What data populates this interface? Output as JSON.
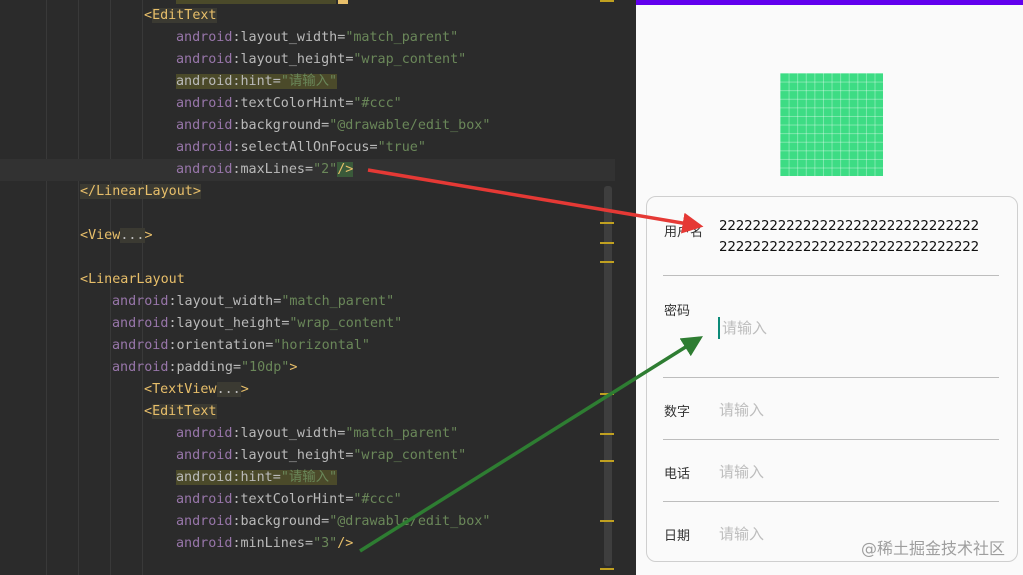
{
  "editor": {
    "lines": [
      {
        "tokens": [
          {
            "t": "<",
            "c": "tk-punc"
          },
          {
            "t": "EditText",
            "c": "tk-tag tk-tagbg"
          }
        ]
      },
      {
        "tokens": [
          {
            "t": "android",
            "c": "tk-ns"
          },
          {
            "t": ":",
            "c": "tk-attr"
          },
          {
            "t": "layout_width",
            "c": "tk-attr"
          },
          {
            "t": "=",
            "c": "tk-attr"
          },
          {
            "t": "\"match_parent\"",
            "c": "tk-val"
          }
        ]
      },
      {
        "tokens": [
          {
            "t": "android",
            "c": "tk-ns"
          },
          {
            "t": ":",
            "c": "tk-attr"
          },
          {
            "t": "layout_height",
            "c": "tk-attr"
          },
          {
            "t": "=",
            "c": "tk-attr"
          },
          {
            "t": "\"wrap_content\"",
            "c": "tk-val"
          }
        ]
      },
      {
        "tokens": [
          {
            "t": "android:hint",
            "c": "tk-attr tk-hlbg"
          },
          {
            "t": "=",
            "c": "tk-attr tk-hlbg"
          },
          {
            "t": "\"请输入\"",
            "c": "tk-val tk-hlbg"
          }
        ]
      },
      {
        "tokens": [
          {
            "t": "android",
            "c": "tk-ns"
          },
          {
            "t": ":",
            "c": "tk-attr"
          },
          {
            "t": "textColorHint",
            "c": "tk-attr"
          },
          {
            "t": "=",
            "c": "tk-attr"
          },
          {
            "t": "\"#ccc\"",
            "c": "tk-val"
          }
        ]
      },
      {
        "tokens": [
          {
            "t": "android",
            "c": "tk-ns"
          },
          {
            "t": ":",
            "c": "tk-attr"
          },
          {
            "t": "background",
            "c": "tk-attr"
          },
          {
            "t": "=",
            "c": "tk-attr"
          },
          {
            "t": "\"@drawable/edit_box\"",
            "c": "tk-val"
          }
        ]
      },
      {
        "tokens": [
          {
            "t": "android",
            "c": "tk-ns"
          },
          {
            "t": ":",
            "c": "tk-attr"
          },
          {
            "t": "selectAllOnFocus",
            "c": "tk-attr"
          },
          {
            "t": "=",
            "c": "tk-attr"
          },
          {
            "t": "\"true\"",
            "c": "tk-val"
          }
        ]
      },
      {
        "tokens": [
          {
            "t": "android",
            "c": "tk-ns"
          },
          {
            "t": ":",
            "c": "tk-attr"
          },
          {
            "t": "maxLines",
            "c": "tk-attr"
          },
          {
            "t": "=",
            "c": "tk-attr"
          },
          {
            "t": "\"2\"",
            "c": "tk-val"
          },
          {
            "t": "/>",
            "c": "tk-punc tk-caret"
          }
        ]
      },
      {
        "tokens": [
          {
            "t": "</LinearLayout>",
            "c": "tk-tag tk-tagbg"
          }
        ]
      },
      {
        "tokens": []
      },
      {
        "tokens": [
          {
            "t": "<",
            "c": "tk-punc"
          },
          {
            "t": "View",
            "c": "tk-tag"
          },
          {
            "t": "...",
            "c": "tk-attr tk-tagbg"
          },
          {
            "t": ">",
            "c": "tk-punc"
          }
        ]
      },
      {
        "tokens": []
      },
      {
        "tokens": [
          {
            "t": "<",
            "c": "tk-punc"
          },
          {
            "t": "LinearLayout",
            "c": "tk-tag"
          }
        ]
      },
      {
        "tokens": [
          {
            "t": "android",
            "c": "tk-ns"
          },
          {
            "t": ":",
            "c": "tk-attr"
          },
          {
            "t": "layout_width",
            "c": "tk-attr"
          },
          {
            "t": "=",
            "c": "tk-attr"
          },
          {
            "t": "\"match_parent\"",
            "c": "tk-val"
          }
        ]
      },
      {
        "tokens": [
          {
            "t": "android",
            "c": "tk-ns"
          },
          {
            "t": ":",
            "c": "tk-attr"
          },
          {
            "t": "layout_height",
            "c": "tk-attr"
          },
          {
            "t": "=",
            "c": "tk-attr"
          },
          {
            "t": "\"wrap_content\"",
            "c": "tk-val"
          }
        ]
      },
      {
        "tokens": [
          {
            "t": "android",
            "c": "tk-ns"
          },
          {
            "t": ":",
            "c": "tk-attr"
          },
          {
            "t": "orientation",
            "c": "tk-attr"
          },
          {
            "t": "=",
            "c": "tk-attr"
          },
          {
            "t": "\"horizontal\"",
            "c": "tk-val"
          }
        ]
      },
      {
        "tokens": [
          {
            "t": "android",
            "c": "tk-ns"
          },
          {
            "t": ":",
            "c": "tk-attr"
          },
          {
            "t": "padding",
            "c": "tk-attr"
          },
          {
            "t": "=",
            "c": "tk-attr"
          },
          {
            "t": "\"10dp\"",
            "c": "tk-val"
          },
          {
            "t": ">",
            "c": "tk-punc"
          }
        ]
      },
      {
        "tokens": [
          {
            "t": "<",
            "c": "tk-punc"
          },
          {
            "t": "TextView",
            "c": "tk-tag"
          },
          {
            "t": "...",
            "c": "tk-attr tk-tagbg"
          },
          {
            "t": ">",
            "c": "tk-punc"
          }
        ]
      },
      {
        "tokens": [
          {
            "t": "<",
            "c": "tk-punc"
          },
          {
            "t": "EditText",
            "c": "tk-tag tk-tagbg"
          }
        ]
      },
      {
        "tokens": [
          {
            "t": "android",
            "c": "tk-ns"
          },
          {
            "t": ":",
            "c": "tk-attr"
          },
          {
            "t": "layout_width",
            "c": "tk-attr"
          },
          {
            "t": "=",
            "c": "tk-attr"
          },
          {
            "t": "\"match_parent\"",
            "c": "tk-val"
          }
        ]
      },
      {
        "tokens": [
          {
            "t": "android",
            "c": "tk-ns"
          },
          {
            "t": ":",
            "c": "tk-attr"
          },
          {
            "t": "layout_height",
            "c": "tk-attr"
          },
          {
            "t": "=",
            "c": "tk-attr"
          },
          {
            "t": "\"wrap_content\"",
            "c": "tk-val"
          }
        ]
      },
      {
        "tokens": [
          {
            "t": "android:hint",
            "c": "tk-attr tk-hlbg"
          },
          {
            "t": "=",
            "c": "tk-attr tk-hlbg"
          },
          {
            "t": "\"请输入\"",
            "c": "tk-val tk-hlbg"
          }
        ]
      },
      {
        "tokens": [
          {
            "t": "android",
            "c": "tk-ns"
          },
          {
            "t": ":",
            "c": "tk-attr"
          },
          {
            "t": "textColorHint",
            "c": "tk-attr"
          },
          {
            "t": "=",
            "c": "tk-attr"
          },
          {
            "t": "\"#ccc\"",
            "c": "tk-val"
          }
        ]
      },
      {
        "tokens": [
          {
            "t": "android",
            "c": "tk-ns"
          },
          {
            "t": ":",
            "c": "tk-attr"
          },
          {
            "t": "background",
            "c": "tk-attr"
          },
          {
            "t": "=",
            "c": "tk-attr"
          },
          {
            "t": "\"@drawable/edit_box\"",
            "c": "tk-val"
          }
        ]
      },
      {
        "tokens": [
          {
            "t": "android",
            "c": "tk-ns"
          },
          {
            "t": ":",
            "c": "tk-attr"
          },
          {
            "t": "minLines",
            "c": "tk-attr"
          },
          {
            "t": "=",
            "c": "tk-attr"
          },
          {
            "t": "\"3\"",
            "c": "tk-val"
          },
          {
            "t": "/>",
            "c": "tk-punc"
          }
        ]
      }
    ]
  },
  "preview": {
    "logo_icon": "android-launcher-icon",
    "fields": [
      {
        "label": "用户名",
        "value_lines": [
          "2222222222222222222222222222222",
          "2222222222222222222222222222222"
        ]
      },
      {
        "label": "密码",
        "placeholder": "请输入"
      },
      {
        "label": "数字",
        "placeholder": "请输入"
      },
      {
        "label": "电话",
        "placeholder": "请输入"
      },
      {
        "label": "日期",
        "placeholder": "请输入"
      }
    ],
    "watermark": "@稀土掘金技术社区"
  },
  "colors": {
    "status_bar": "#6200ee",
    "arrow_red": "#e53935",
    "arrow_green": "#2e7d32",
    "logo": "#3ddc84"
  }
}
